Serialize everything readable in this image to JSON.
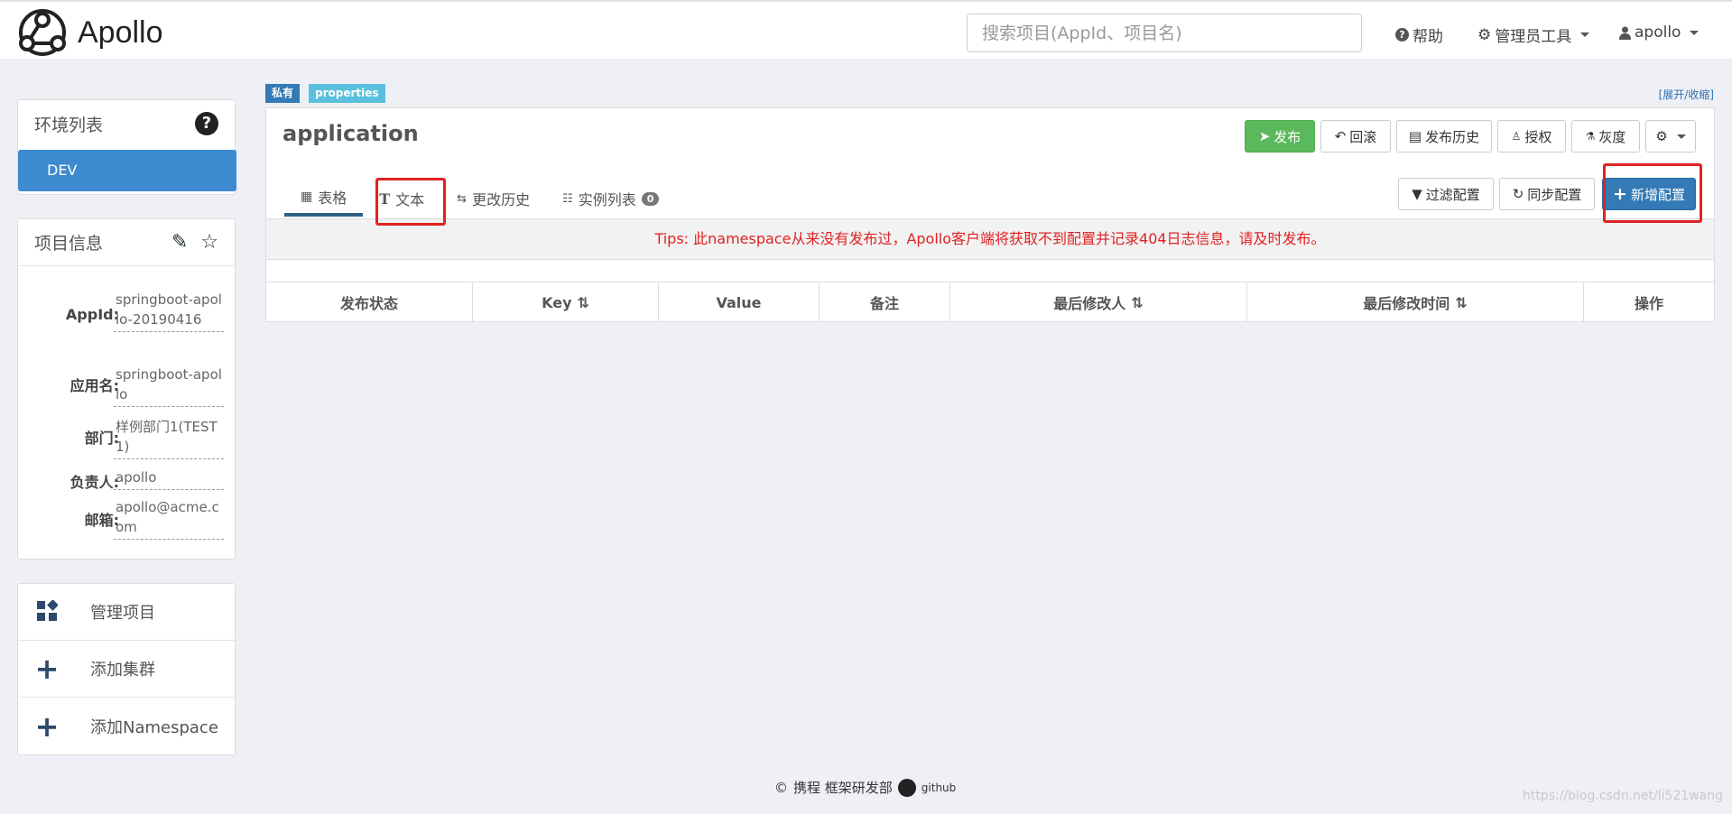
{
  "app": {
    "name": "Apollo"
  },
  "search": {
    "placeholder": "搜索项目(AppId、项目名)"
  },
  "nav": {
    "help": "帮助",
    "admin_tools": "管理员工具",
    "user": "apollo"
  },
  "env_panel": {
    "title": "环境列表",
    "items": [
      {
        "label": "DEV",
        "active": true
      }
    ]
  },
  "info_panel": {
    "title": "项目信息",
    "fields": [
      {
        "label": "AppId:",
        "value": "springboot-apollo-20190416"
      },
      {
        "label": "应用名:",
        "value": "springboot-apollo"
      },
      {
        "label": "部门:",
        "value": "样例部门1(TEST1)"
      },
      {
        "label": "负责人:",
        "value": "apollo"
      },
      {
        "label": "邮箱:",
        "value": "apollo@acme.com"
      }
    ]
  },
  "actions": [
    {
      "label": "管理项目",
      "icon": "grid-icon"
    },
    {
      "label": "添加集群",
      "icon": "plus-icon"
    },
    {
      "label": "添加Namespace",
      "icon": "plus-icon"
    }
  ],
  "namespace": {
    "tags": [
      {
        "label": "私有",
        "color": "#337ab7"
      },
      {
        "label": "properties",
        "color": "#5bc0de"
      }
    ],
    "toggle": "[展开/收缩]",
    "title": "application",
    "buttons": {
      "publish": "发布",
      "rollback": "回滚",
      "history": "发布历史",
      "grant": "授权",
      "gray": "灰度"
    },
    "tabs": [
      {
        "label": "表格",
        "active": true
      },
      {
        "label": "文本"
      },
      {
        "label": "更改历史"
      },
      {
        "label": "实例列表",
        "badge": "0"
      }
    ],
    "tools": {
      "filter": "过滤配置",
      "sync": "同步配置",
      "add": "新增配置"
    },
    "tips": "Tips: 此namespace从来没有发布过，Apollo客户端将获取不到配置并记录404日志信息，请及时发布。",
    "columns": [
      "发布状态",
      "Key",
      "Value",
      "备注",
      "最后修改人",
      "最后修改时间",
      "操作"
    ]
  },
  "footer": {
    "company": "携程 框架研发部",
    "github": "github"
  },
  "watermark": "https://blog.csdn.net/li521wang"
}
